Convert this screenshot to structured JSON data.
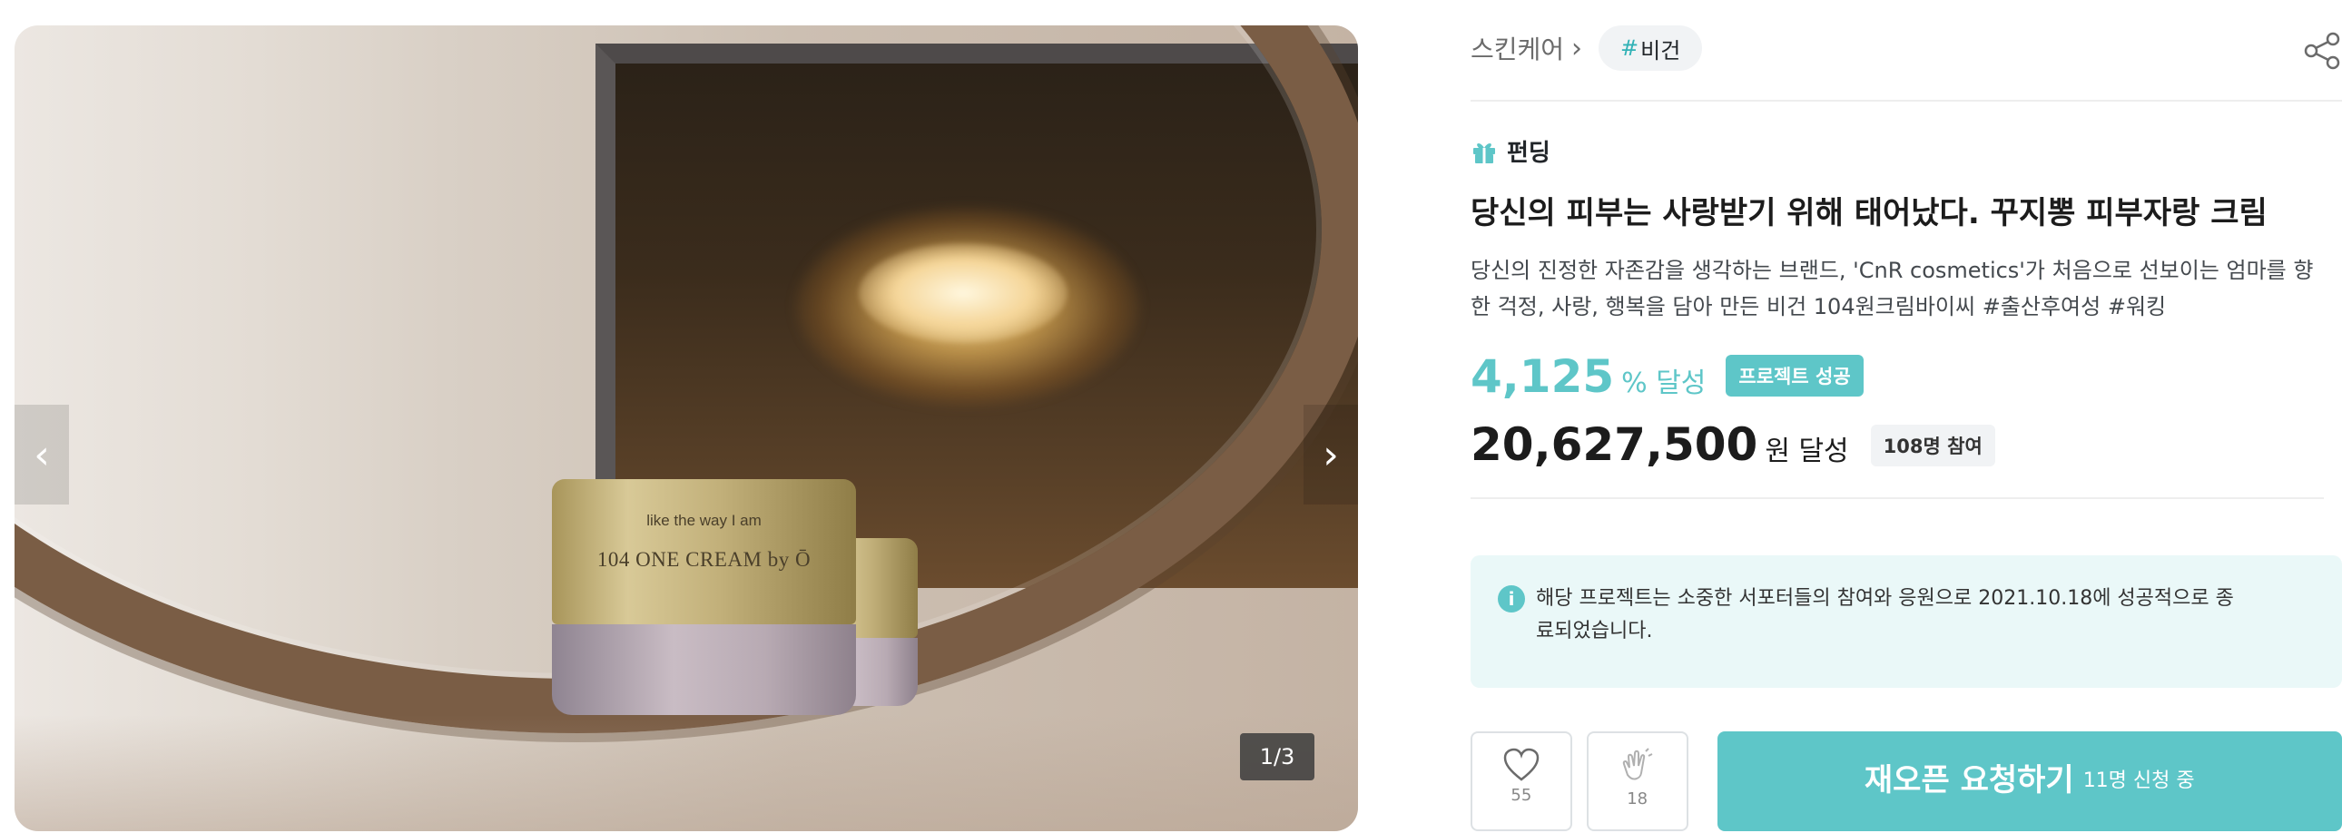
{
  "gallery": {
    "jar_tagline": "like the way I am",
    "jar_brand": "104 ONE CREAM by",
    "jar_logo": "Ō",
    "counter": "1/3",
    "prev_arrow": "‹",
    "next_arrow": "›"
  },
  "breadcrumb": {
    "category": "스킨케어",
    "chevron": "›",
    "tag_hash": "#",
    "tag_label": "비건"
  },
  "project": {
    "type_label": "펀딩",
    "title": "당신의 피부는 사랑받기 위해 태어났다. 꾸지뽕 피부자랑 크림",
    "description": "당신의 진정한 자존감을 생각하는 브랜드, 'CnR cosmetics'가 처음으로 선보이는 엄마를 향한 걱정, 사랑, 행복을 담아 만든 비건 104원크림바이씨 #출산후여성 #워킹",
    "achievement_rate": "4,125",
    "achievement_unit": "% 달성",
    "success_badge": "프로젝트 성공",
    "amount": "20,627,500",
    "amount_unit": "원 달성",
    "supporters": "108명 참여"
  },
  "notice": {
    "icon": "i",
    "text": "해당 프로젝트는 소중한 서포터들의 참여와 응원으로 2021.10.18에 성공적으로 종료되었습니다."
  },
  "actions": {
    "like_count": "55",
    "cheer_count": "18",
    "cta_label": "재오픈 요청하기",
    "cta_sub": "11명 신청 중"
  },
  "colors": {
    "accent": "#5ec6c8",
    "tag_hash": "#31b2b6",
    "notice_bg": "#eaf8f8"
  },
  "icons": [
    "share-icon",
    "gift-icon",
    "info-icon",
    "heart-icon",
    "clap-icon",
    "chevron-left-icon",
    "chevron-right-icon"
  ]
}
